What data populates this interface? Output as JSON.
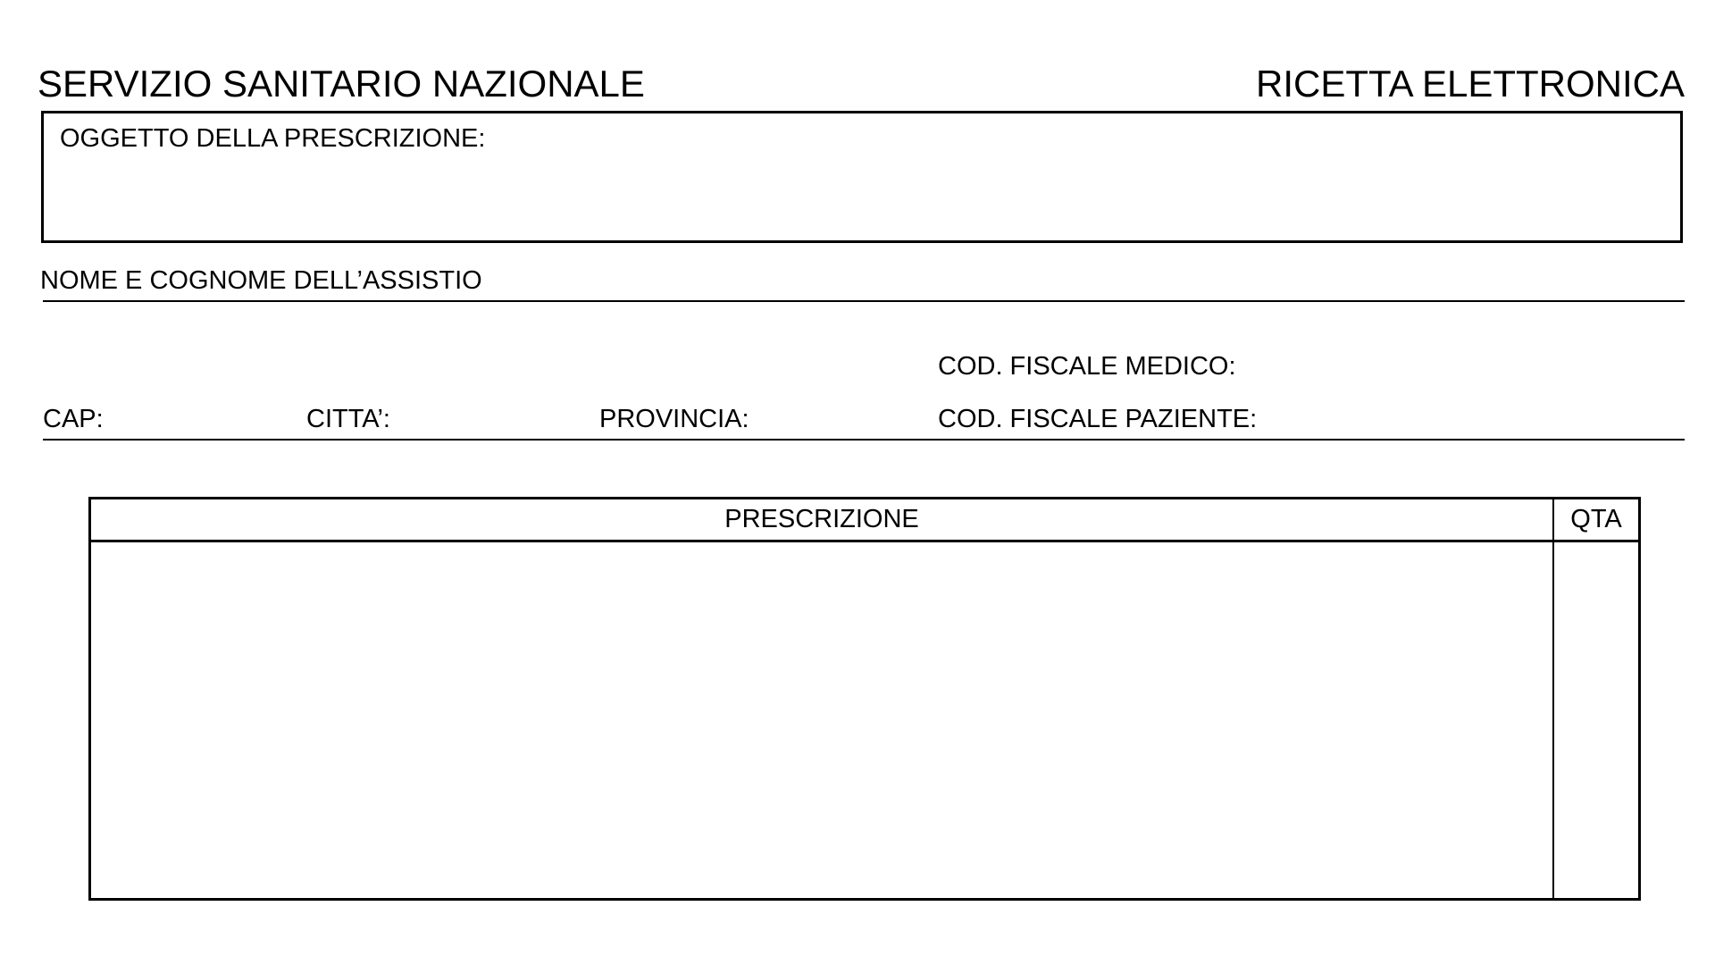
{
  "header": {
    "left_title": "SERVIZIO SANITARIO NAZIONALE",
    "right_title": "RICETTA ELETTRONICA"
  },
  "object_box": {
    "label": "OGGETTO DELLA PRESCRIZIONE:"
  },
  "patient": {
    "name_label": "NOME E COGNOME DELL’ASSISTIO"
  },
  "address": {
    "cap_label": "CAP:",
    "city_label": "CITTA’:",
    "province_label": "PROVINCIA:",
    "doctor_tax_code_label": "COD. FISCALE MEDICO:",
    "patient_tax_code_label": "COD. FISCALE PAZIENTE:"
  },
  "prescription_table": {
    "prescription_header": "PRESCRIZIONE",
    "quantity_header": "QTA"
  }
}
